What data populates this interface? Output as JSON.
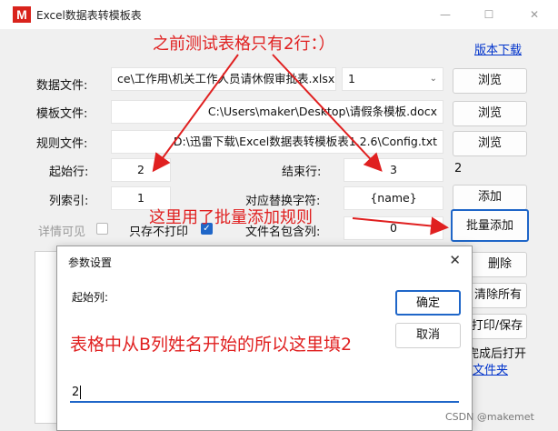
{
  "window": {
    "title": "Excel数据表转模板表",
    "logo": "M",
    "close_icon": "✕"
  },
  "annotations": {
    "top": "之前测试表格只有2行：）",
    "middle": "这里用了批量添加规则",
    "dialog": "表格中从B列姓名开始的所以这里填2"
  },
  "header": {
    "version_link": "版本下载"
  },
  "form": {
    "data_file_label": "数据文件:",
    "data_file_value": "ce\\工作用\\机关工作人员请休假审批表.xlsx",
    "sheet_select_value": "1",
    "template_file_label": "模板文件:",
    "template_file_value": "C:\\Users\\maker\\Desktop\\请假条模板.docx",
    "rule_file_label": "规则文件:",
    "rule_file_value": "D:\\迅雷下载\\Excel数据表转模板表1.2.6\\Config.txt",
    "browse_label": "浏览",
    "start_row_label": "起始行:",
    "start_row_value": "2",
    "end_row_label": "结束行:",
    "end_row_value": "3",
    "row_count": "2",
    "col_index_label": "列索引:",
    "col_index_value": "1",
    "replace_label": "对应替换字符:",
    "replace_value": "{name}",
    "add_button": "添加",
    "detail_visible_label": "详情可见",
    "save_only_label": "只存不打印",
    "filename_col_label": "文件名包含列:",
    "filename_col_value": "0",
    "batch_add_button": "批量添加",
    "delete_button": "删除",
    "clear_all_button": "清除所有",
    "print_save_button": "打印/保存",
    "open_after_label": "完成后打开",
    "folder_link": "文件夹"
  },
  "dialog": {
    "title": "参数设置",
    "start_col_label": "起始列:",
    "ok_button": "确定",
    "cancel_button": "取消",
    "input_value": "2"
  },
  "watermark": "CSDN @makemet"
}
